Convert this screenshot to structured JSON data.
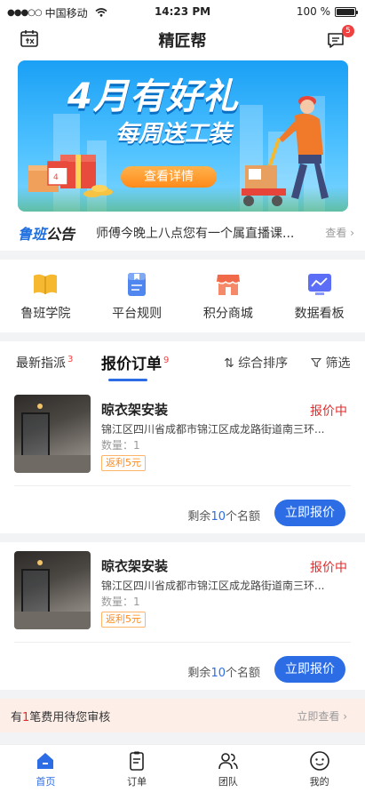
{
  "status_bar": {
    "signal": "●●●○○",
    "carrier": "中国移动",
    "time": "14:23 PM",
    "battery": "100 %",
    "battery_level": 1.0
  },
  "header": {
    "title": "精匠帮",
    "message_badge": "5"
  },
  "banner": {
    "headline": "4月有好礼",
    "subline": "每周送工装",
    "cta": "查看详情"
  },
  "notice": {
    "brand_part1": "鲁班",
    "brand_part2": "公告",
    "text": "师傅今晚上八点您有一个属直播课...",
    "more": "查看 ›"
  },
  "quick_entries": [
    {
      "label": "鲁班学院",
      "icon": "book-icon",
      "color": "#f5b82e"
    },
    {
      "label": "平台规则",
      "icon": "rules-icon",
      "color": "#4f86f0"
    },
    {
      "label": "积分商城",
      "icon": "store-icon",
      "color": "#f06a4a"
    },
    {
      "label": "数据看板",
      "icon": "dashboard-icon",
      "color": "#5b6ef5"
    }
  ],
  "tabs": {
    "latest": {
      "label": "最新指派",
      "count": "3"
    },
    "quote": {
      "label": "报价订单",
      "count": "9"
    },
    "sort": "⇅ 综合排序",
    "filter": "筛选"
  },
  "orders": [
    {
      "name": "晾衣架安装",
      "status": "报价中",
      "address": "锦江区四川省成都市锦江区成龙路街道南三环...",
      "quantity": "数量：1",
      "rebate": "返利5元",
      "remain_prefix": "剩余",
      "remain_count": "10",
      "remain_suffix": "个名额",
      "action": "立即报价"
    },
    {
      "name": "晾衣架安装",
      "status": "报价中",
      "address": "锦江区四川省成都市锦江区成龙路街道南三环...",
      "quantity": "数量：1",
      "rebate": "返利5元",
      "remain_prefix": "剩余",
      "remain_count": "10",
      "remain_suffix": "个名额",
      "action": "立即报价"
    }
  ],
  "pending": {
    "prefix": "有",
    "count": "1",
    "suffix": "笔费用待您审核",
    "action": "立即查看 ›"
  },
  "tabbar": [
    {
      "label": "首页",
      "icon": "home-icon",
      "active": true
    },
    {
      "label": "订单",
      "icon": "order-icon",
      "active": false
    },
    {
      "label": "团队",
      "icon": "team-icon",
      "active": false
    },
    {
      "label": "我的",
      "icon": "profile-icon",
      "active": false
    }
  ],
  "colors": {
    "primary": "#2c6de5",
    "danger": "#e02b2b",
    "rebate": "#ff8a1c"
  }
}
